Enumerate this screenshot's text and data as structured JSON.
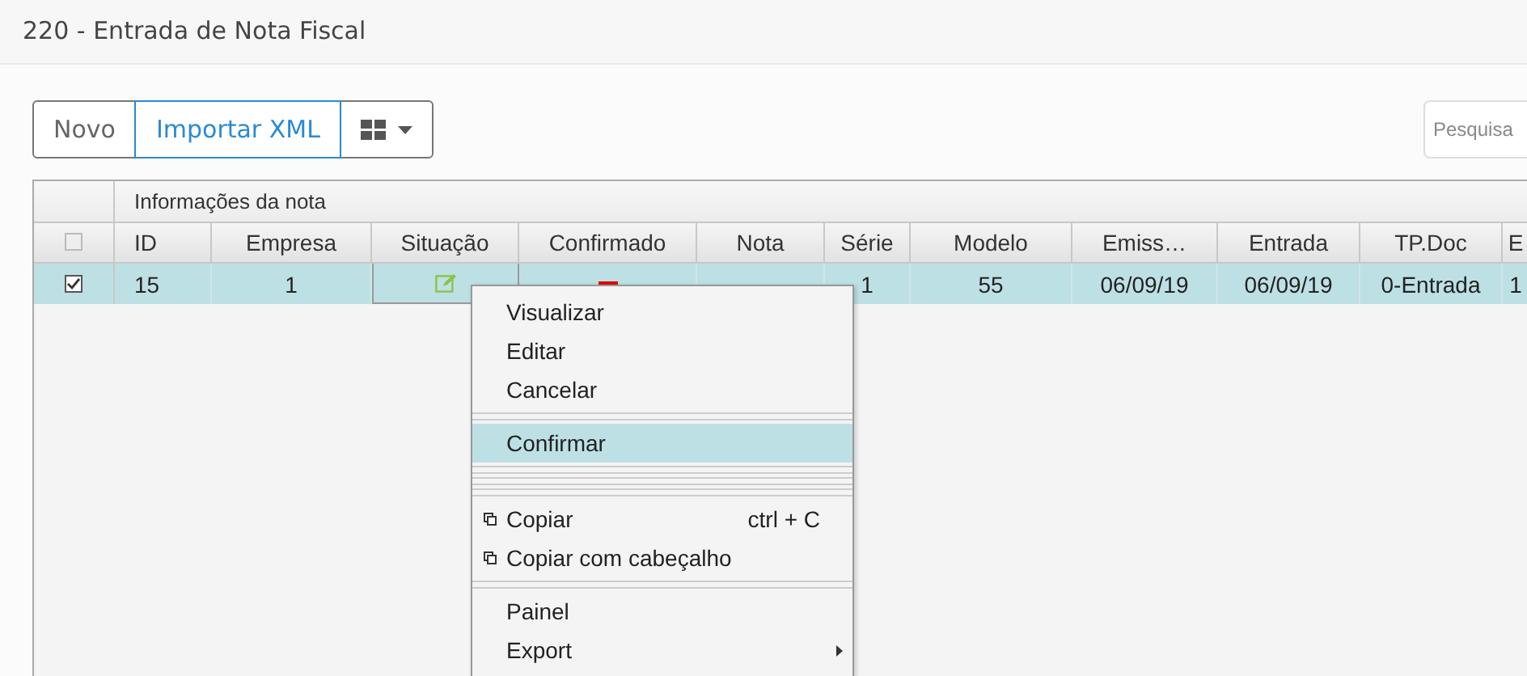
{
  "window": {
    "title": "220 - Entrada de Nota Fiscal"
  },
  "toolbar": {
    "buttons": [
      {
        "label": "Novo",
        "kind": "plain"
      },
      {
        "label": "Importar XML",
        "kind": "primary"
      },
      {
        "kind": "grid-dropdown"
      }
    ],
    "search": {
      "placeholder": "Pesquisa"
    }
  },
  "table": {
    "group_header": "Informações da nota",
    "header_checked": false,
    "columns": [
      "ID",
      "Empresa",
      "Situação",
      "Confirmado",
      "Nota",
      "Série",
      "Modelo",
      "Emiss…",
      "Entrada",
      "TP.Doc",
      "E"
    ],
    "rows": [
      {
        "checked": true,
        "selected": true,
        "cells": [
          {
            "kind": "text",
            "text": "15"
          },
          {
            "kind": "text",
            "text": "1"
          },
          {
            "kind": "edit-icon"
          },
          {
            "kind": "red-dash"
          },
          {
            "kind": "covered"
          },
          {
            "kind": "text",
            "text": "1"
          },
          {
            "kind": "text",
            "text": "55"
          },
          {
            "kind": "text",
            "text": "06/09/19"
          },
          {
            "kind": "text",
            "text": "06/09/19"
          },
          {
            "kind": "text",
            "text": "0-Entrada"
          },
          {
            "kind": "text",
            "text": "1"
          }
        ]
      }
    ]
  },
  "context_menu": {
    "items": [
      {
        "kind": "item",
        "label": "Visualizar",
        "selected": false
      },
      {
        "kind": "item",
        "label": "Editar",
        "selected": false
      },
      {
        "kind": "item",
        "label": "Cancelar",
        "selected": false
      },
      {
        "kind": "separator"
      },
      {
        "kind": "item",
        "label": "Confirmar",
        "selected": true
      },
      {
        "kind": "separator"
      },
      {
        "kind": "separator"
      },
      {
        "kind": "separator"
      },
      {
        "kind": "copy",
        "label": "Copiar",
        "shortcut": "ctrl + C",
        "selected": false
      },
      {
        "kind": "copy",
        "label": "Copiar com cabeçalho",
        "selected": false
      },
      {
        "kind": "separator"
      },
      {
        "kind": "item",
        "label": "Painel",
        "selected": false
      },
      {
        "kind": "submenu",
        "label": "Export",
        "selected": false
      }
    ]
  }
}
